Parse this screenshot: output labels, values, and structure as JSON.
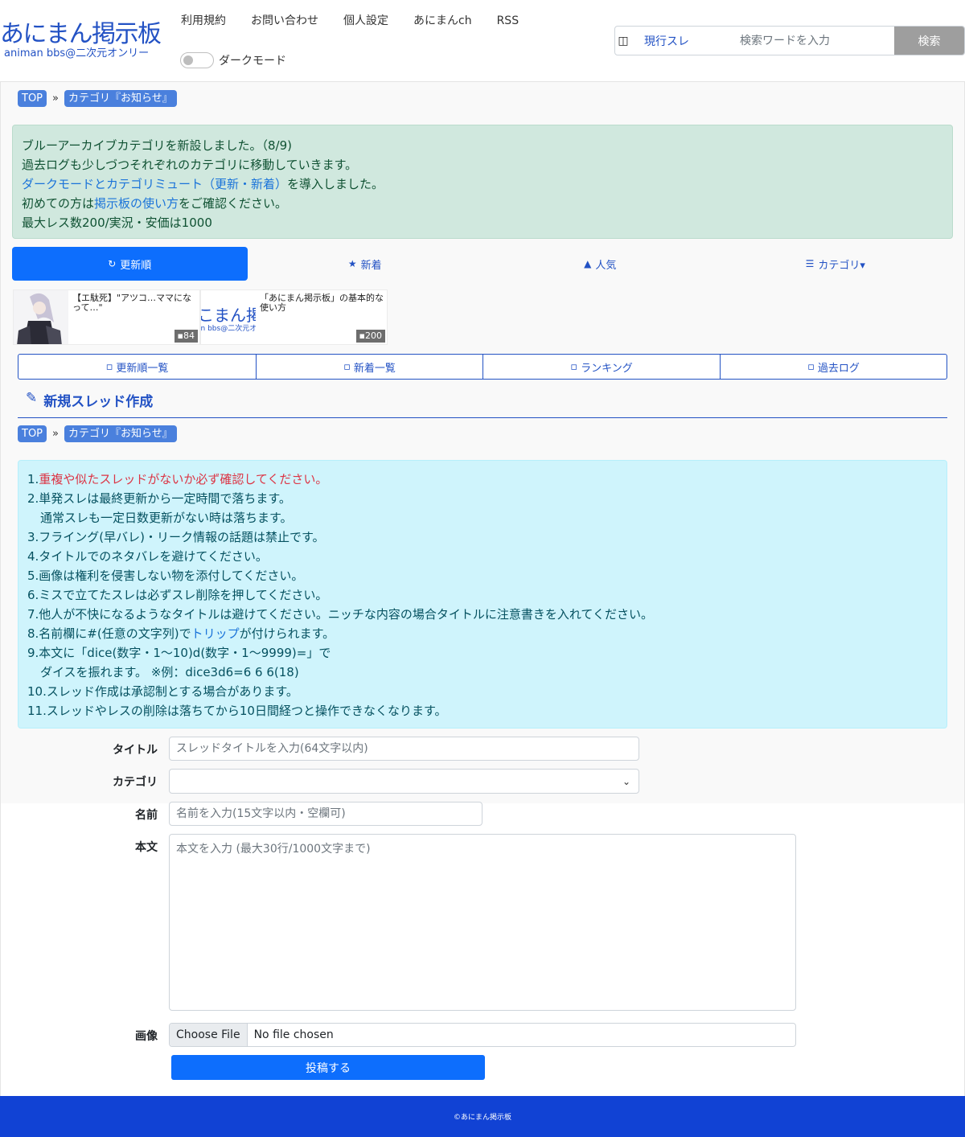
{
  "header": {
    "logo_main": "あにまん掲示板",
    "logo_sub": "animan bbs@二次元オンリー",
    "nav": [
      "利用規約",
      "お問い合わせ",
      "個人設定",
      "あにまんch",
      "RSS"
    ],
    "darkmode_label": "ダークモード",
    "search": {
      "icon": "search-icon",
      "select_value": "現行スレ",
      "placeholder": "検索ワードを入力",
      "button": "検索"
    }
  },
  "breadcrumb": {
    "top": "TOP",
    "sep": "»",
    "category": "カテゴリ『お知らせ』"
  },
  "notice": {
    "line1": "ブルーアーカイブカテゴリを新設しました。（8/9)",
    "line2": "過去ログも少しづつそれぞれのカテゴリに移動していきます。",
    "line3_link": "ダークモードとカテゴリミュート（更新・新着）",
    "line3_rest": "を導入しました。",
    "line4_pre": "初めての方は",
    "line4_link": "掲示板の使い方",
    "line4_post": "をご確認ください。",
    "line5": "最大レス数200/実況・安価は1000"
  },
  "tabs": [
    {
      "label": "更新順",
      "icon": "refresh-icon",
      "active": true
    },
    {
      "label": "新着",
      "icon": "new-icon",
      "active": false
    },
    {
      "label": "人気",
      "icon": "fire-icon",
      "active": false
    },
    {
      "label": "カテゴリ▾",
      "icon": "list-icon",
      "active": false
    }
  ],
  "threads": [
    {
      "title": "【エ駄死】\"アツコ…ママになって…\"",
      "count": "84"
    },
    {
      "title": "「あにまん掲示板」の基本的な使い方",
      "count": "200"
    }
  ],
  "subnav": [
    "更新順一覧",
    "新着一覧",
    "ランキング",
    "過去ログ"
  ],
  "section_title": "新規スレッド作成",
  "rules": {
    "r1_num": "1.",
    "r1_text": "重複や似たスレッドがないか必ず確認してください。",
    "r2a": "2.単発スレは最終更新から一定時間で落ちます。",
    "r2b": "通常スレも一定日数更新がない時は落ちます。",
    "r3": "3.フライング(早バレ)・リーク情報の話題は禁止です。",
    "r4": "4.タイトルでのネタバレを避けてください。",
    "r5": "5.画像は権利を侵害しない物を添付してください。",
    "r6": "6.ミスで立てたスレは必ずスレ削除を押してください。",
    "r7": "7.他人が不快になるようなタイトルは避けてください。ニッチな内容の場合タイトルに注意書きを入れてください。",
    "r8_pre": "8.名前欄に#(任意の文字列)で",
    "r8_link": "トリップ",
    "r8_post": "が付けられます。",
    "r9a": "9.本文に「dice(数字・1〜10)d(数字・1〜9999)=」で",
    "r9b": "ダイスを振れます。 ※例：dice3d6=6 6 6(18)",
    "r10": "10.スレッド作成は承認制とする場合があります。",
    "r11": "11.スレッドやレスの削除は落ちてから10日間経つと操作できなくなります。"
  },
  "form": {
    "title_label": "タイトル",
    "title_placeholder": "スレッドタイトルを入力(64文字以内)",
    "category_label": "カテゴリ",
    "category_value": "",
    "name_label": "名前",
    "name_placeholder": "名前を入力(15文字以内・空欄可)",
    "body_label": "本文",
    "body_placeholder": "本文を入力 (最大30行/1000文字まで)",
    "image_label": "画像",
    "file_button": "Choose File",
    "file_status": "No file chosen",
    "submit": "投稿する"
  },
  "footer": {
    "copyright": "©あにまん掲示板"
  },
  "colors": {
    "brand_blue": "#2352c4",
    "primary": "#0d6efd",
    "footer": "#1142d4"
  }
}
